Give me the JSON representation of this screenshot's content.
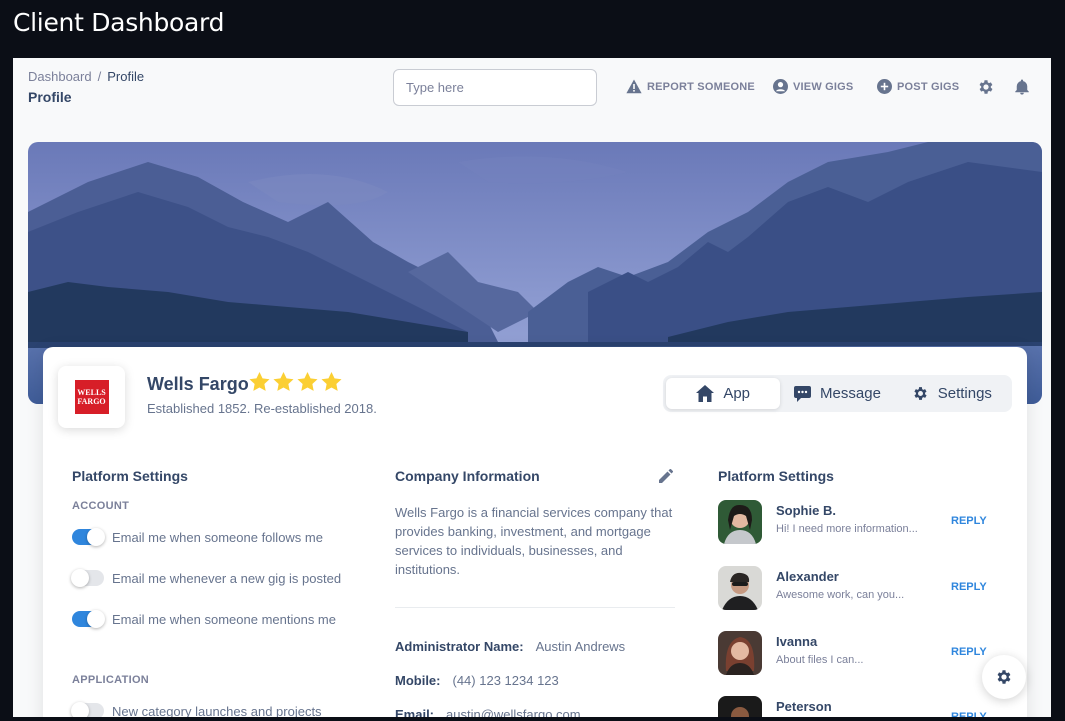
{
  "app": {
    "title": "Client Dashboard"
  },
  "navbar": {
    "breadcrumb": {
      "parent": "Dashboard",
      "separator": "/",
      "current": "Profile"
    },
    "page_title": "Profile",
    "search": {
      "placeholder": "Type here",
      "value": ""
    },
    "links": [
      {
        "label": "REPORT SOMEONE",
        "icon": "warning-icon"
      },
      {
        "label": "VIEW GIGS",
        "icon": "user-circle-icon"
      },
      {
        "label": "POST GIGS",
        "icon": "plus-circle-icon"
      }
    ],
    "icons": [
      "gear-icon",
      "bell-icon"
    ]
  },
  "profile": {
    "logo_text_line1": "WELLS",
    "logo_text_line2": "FARGO",
    "name": "Wells Fargo",
    "rating": 4,
    "rating_max": 4,
    "established": "Established 1852. Re-established 2018.",
    "tabs": [
      {
        "label": "App",
        "icon": "home-icon",
        "active": true
      },
      {
        "label": "Message",
        "icon": "chat-icon",
        "active": false
      },
      {
        "label": "Settings",
        "icon": "gear-icon",
        "active": false
      }
    ]
  },
  "platform_settings": {
    "title": "Platform Settings",
    "account_label": "ACCOUNT",
    "account_toggles": [
      {
        "label": "Email me when someone follows me",
        "on": true
      },
      {
        "label": "Email me whenever a new gig is posted",
        "on": false
      },
      {
        "label": "Email me when someone mentions me",
        "on": true
      }
    ],
    "application_label": "APPLICATION",
    "application_toggles": [
      {
        "label": "New category launches and projects",
        "on": false
      }
    ]
  },
  "company_info": {
    "title": "Company Information",
    "description": "Wells Fargo is a financial services company that provides banking, investment, and mortgage services to individuals, businesses, and institutions.",
    "rows": [
      {
        "label": "Administrator Name:",
        "value": "Austin Andrews"
      },
      {
        "label": "Mobile:",
        "value": "(44) 123 1234 123"
      },
      {
        "label": "Email:",
        "value": "austin@wellsfargo.com"
      }
    ]
  },
  "conversations": {
    "title": "Platform Settings",
    "reply_label": "REPLY",
    "items": [
      {
        "name": "Sophie B.",
        "preview": "Hi! I need more information..."
      },
      {
        "name": "Alexander",
        "preview": "Awesome work, can you..."
      },
      {
        "name": "Ivanna",
        "preview": "About files I can..."
      },
      {
        "name": "Peterson",
        "preview": ""
      }
    ]
  },
  "colors": {
    "accent": "#2f86dd",
    "star": "#fbcf33",
    "header_bg": "#0b0e16",
    "brand_red": "#d71e28"
  }
}
